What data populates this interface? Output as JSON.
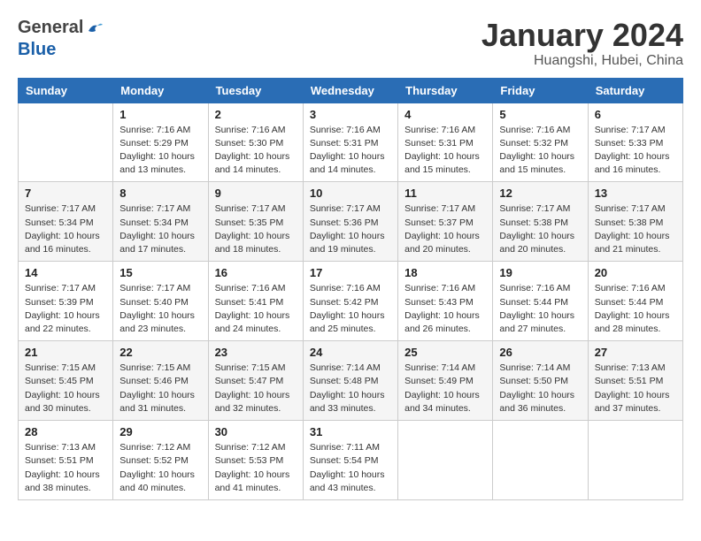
{
  "logo": {
    "general": "General",
    "blue": "Blue"
  },
  "title": "January 2024",
  "subtitle": "Huangshi, Hubei, China",
  "days_of_week": [
    "Sunday",
    "Monday",
    "Tuesday",
    "Wednesday",
    "Thursday",
    "Friday",
    "Saturday"
  ],
  "weeks": [
    [
      {
        "num": "",
        "sunrise": "",
        "sunset": "",
        "daylight": ""
      },
      {
        "num": "1",
        "sunrise": "Sunrise: 7:16 AM",
        "sunset": "Sunset: 5:29 PM",
        "daylight": "Daylight: 10 hours and 13 minutes."
      },
      {
        "num": "2",
        "sunrise": "Sunrise: 7:16 AM",
        "sunset": "Sunset: 5:30 PM",
        "daylight": "Daylight: 10 hours and 14 minutes."
      },
      {
        "num": "3",
        "sunrise": "Sunrise: 7:16 AM",
        "sunset": "Sunset: 5:31 PM",
        "daylight": "Daylight: 10 hours and 14 minutes."
      },
      {
        "num": "4",
        "sunrise": "Sunrise: 7:16 AM",
        "sunset": "Sunset: 5:31 PM",
        "daylight": "Daylight: 10 hours and 15 minutes."
      },
      {
        "num": "5",
        "sunrise": "Sunrise: 7:16 AM",
        "sunset": "Sunset: 5:32 PM",
        "daylight": "Daylight: 10 hours and 15 minutes."
      },
      {
        "num": "6",
        "sunrise": "Sunrise: 7:17 AM",
        "sunset": "Sunset: 5:33 PM",
        "daylight": "Daylight: 10 hours and 16 minutes."
      }
    ],
    [
      {
        "num": "7",
        "sunrise": "Sunrise: 7:17 AM",
        "sunset": "Sunset: 5:34 PM",
        "daylight": "Daylight: 10 hours and 16 minutes."
      },
      {
        "num": "8",
        "sunrise": "Sunrise: 7:17 AM",
        "sunset": "Sunset: 5:34 PM",
        "daylight": "Daylight: 10 hours and 17 minutes."
      },
      {
        "num": "9",
        "sunrise": "Sunrise: 7:17 AM",
        "sunset": "Sunset: 5:35 PM",
        "daylight": "Daylight: 10 hours and 18 minutes."
      },
      {
        "num": "10",
        "sunrise": "Sunrise: 7:17 AM",
        "sunset": "Sunset: 5:36 PM",
        "daylight": "Daylight: 10 hours and 19 minutes."
      },
      {
        "num": "11",
        "sunrise": "Sunrise: 7:17 AM",
        "sunset": "Sunset: 5:37 PM",
        "daylight": "Daylight: 10 hours and 20 minutes."
      },
      {
        "num": "12",
        "sunrise": "Sunrise: 7:17 AM",
        "sunset": "Sunset: 5:38 PM",
        "daylight": "Daylight: 10 hours and 20 minutes."
      },
      {
        "num": "13",
        "sunrise": "Sunrise: 7:17 AM",
        "sunset": "Sunset: 5:38 PM",
        "daylight": "Daylight: 10 hours and 21 minutes."
      }
    ],
    [
      {
        "num": "14",
        "sunrise": "Sunrise: 7:17 AM",
        "sunset": "Sunset: 5:39 PM",
        "daylight": "Daylight: 10 hours and 22 minutes."
      },
      {
        "num": "15",
        "sunrise": "Sunrise: 7:17 AM",
        "sunset": "Sunset: 5:40 PM",
        "daylight": "Daylight: 10 hours and 23 minutes."
      },
      {
        "num": "16",
        "sunrise": "Sunrise: 7:16 AM",
        "sunset": "Sunset: 5:41 PM",
        "daylight": "Daylight: 10 hours and 24 minutes."
      },
      {
        "num": "17",
        "sunrise": "Sunrise: 7:16 AM",
        "sunset": "Sunset: 5:42 PM",
        "daylight": "Daylight: 10 hours and 25 minutes."
      },
      {
        "num": "18",
        "sunrise": "Sunrise: 7:16 AM",
        "sunset": "Sunset: 5:43 PM",
        "daylight": "Daylight: 10 hours and 26 minutes."
      },
      {
        "num": "19",
        "sunrise": "Sunrise: 7:16 AM",
        "sunset": "Sunset: 5:44 PM",
        "daylight": "Daylight: 10 hours and 27 minutes."
      },
      {
        "num": "20",
        "sunrise": "Sunrise: 7:16 AM",
        "sunset": "Sunset: 5:44 PM",
        "daylight": "Daylight: 10 hours and 28 minutes."
      }
    ],
    [
      {
        "num": "21",
        "sunrise": "Sunrise: 7:15 AM",
        "sunset": "Sunset: 5:45 PM",
        "daylight": "Daylight: 10 hours and 30 minutes."
      },
      {
        "num": "22",
        "sunrise": "Sunrise: 7:15 AM",
        "sunset": "Sunset: 5:46 PM",
        "daylight": "Daylight: 10 hours and 31 minutes."
      },
      {
        "num": "23",
        "sunrise": "Sunrise: 7:15 AM",
        "sunset": "Sunset: 5:47 PM",
        "daylight": "Daylight: 10 hours and 32 minutes."
      },
      {
        "num": "24",
        "sunrise": "Sunrise: 7:14 AM",
        "sunset": "Sunset: 5:48 PM",
        "daylight": "Daylight: 10 hours and 33 minutes."
      },
      {
        "num": "25",
        "sunrise": "Sunrise: 7:14 AM",
        "sunset": "Sunset: 5:49 PM",
        "daylight": "Daylight: 10 hours and 34 minutes."
      },
      {
        "num": "26",
        "sunrise": "Sunrise: 7:14 AM",
        "sunset": "Sunset: 5:50 PM",
        "daylight": "Daylight: 10 hours and 36 minutes."
      },
      {
        "num": "27",
        "sunrise": "Sunrise: 7:13 AM",
        "sunset": "Sunset: 5:51 PM",
        "daylight": "Daylight: 10 hours and 37 minutes."
      }
    ],
    [
      {
        "num": "28",
        "sunrise": "Sunrise: 7:13 AM",
        "sunset": "Sunset: 5:51 PM",
        "daylight": "Daylight: 10 hours and 38 minutes."
      },
      {
        "num": "29",
        "sunrise": "Sunrise: 7:12 AM",
        "sunset": "Sunset: 5:52 PM",
        "daylight": "Daylight: 10 hours and 40 minutes."
      },
      {
        "num": "30",
        "sunrise": "Sunrise: 7:12 AM",
        "sunset": "Sunset: 5:53 PM",
        "daylight": "Daylight: 10 hours and 41 minutes."
      },
      {
        "num": "31",
        "sunrise": "Sunrise: 7:11 AM",
        "sunset": "Sunset: 5:54 PM",
        "daylight": "Daylight: 10 hours and 43 minutes."
      },
      {
        "num": "",
        "sunrise": "",
        "sunset": "",
        "daylight": ""
      },
      {
        "num": "",
        "sunrise": "",
        "sunset": "",
        "daylight": ""
      },
      {
        "num": "",
        "sunrise": "",
        "sunset": "",
        "daylight": ""
      }
    ]
  ]
}
